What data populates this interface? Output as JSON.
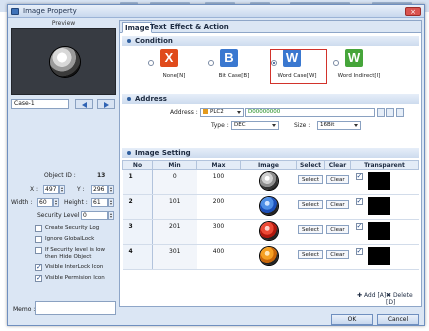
{
  "window": {
    "title": "Image Property",
    "close_label": "×"
  },
  "left": {
    "preview_label": "Preview",
    "case_value": "Case-1",
    "object_id_label": "Object ID :",
    "object_id": "13",
    "x_label": "X :",
    "x_value": "497",
    "y_label": "Y :",
    "y_value": "296",
    "width_label": "Width :",
    "width_value": "60",
    "height_label": "Height :",
    "height_value": "61",
    "security_label": "Security Level :",
    "security_value": "0",
    "checks": [
      {
        "label": "Create Security Log",
        "checked": false
      },
      {
        "label": "Ignore GlobalLock",
        "checked": false
      },
      {
        "label": "If Security level is low then Hide Object",
        "checked": false
      },
      {
        "label": "Visible InterLock Icon",
        "checked": true
      },
      {
        "label": "Visible Permision Icon",
        "checked": true
      }
    ],
    "memo_label": "Memo :"
  },
  "tabs": [
    "Image",
    "Text",
    "Effect & Action"
  ],
  "condition": {
    "title": "Condition",
    "options": [
      {
        "label": "None[N]",
        "icon": "X",
        "color": "#e04b1c",
        "selected": false
      },
      {
        "label": "Bit Case[B]",
        "icon": "B",
        "color": "#3a78d0",
        "selected": false
      },
      {
        "label": "Word Case[W]",
        "icon": "W",
        "color": "#3a78d0",
        "selected": true
      },
      {
        "label": "Word Indirect[I]",
        "icon": "W",
        "color": "#46a53a",
        "selected": false
      }
    ]
  },
  "address": {
    "title": "Address",
    "address_label": "Address :",
    "device": "PLC2",
    "address_value": "D00000000",
    "type_label": "Type :",
    "type_value": "DEC",
    "size_label": "Size :",
    "size_value": "16Bit"
  },
  "image_setting": {
    "title": "Image Setting",
    "columns": [
      "No",
      "Min",
      "Max",
      "Image",
      "Select",
      "Clear",
      "Transparent"
    ],
    "rows": [
      {
        "no": "1",
        "min": "0",
        "max": "100",
        "lamp": "gray",
        "select": "Select",
        "clear": "Clear",
        "transparent": true
      },
      {
        "no": "2",
        "min": "101",
        "max": "200",
        "lamp": "blue",
        "select": "Select",
        "clear": "Clear",
        "transparent": true
      },
      {
        "no": "3",
        "min": "201",
        "max": "300",
        "lamp": "red",
        "select": "Select",
        "clear": "Clear",
        "transparent": true
      },
      {
        "no": "4",
        "min": "301",
        "max": "400",
        "lamp": "orange",
        "select": "Select",
        "clear": "Clear",
        "transparent": true
      }
    ],
    "add_label": "Add [A]",
    "delete_label": "Delete [D]"
  },
  "footer": {
    "ok_label": "OK",
    "cancel_label": "Cancel"
  }
}
